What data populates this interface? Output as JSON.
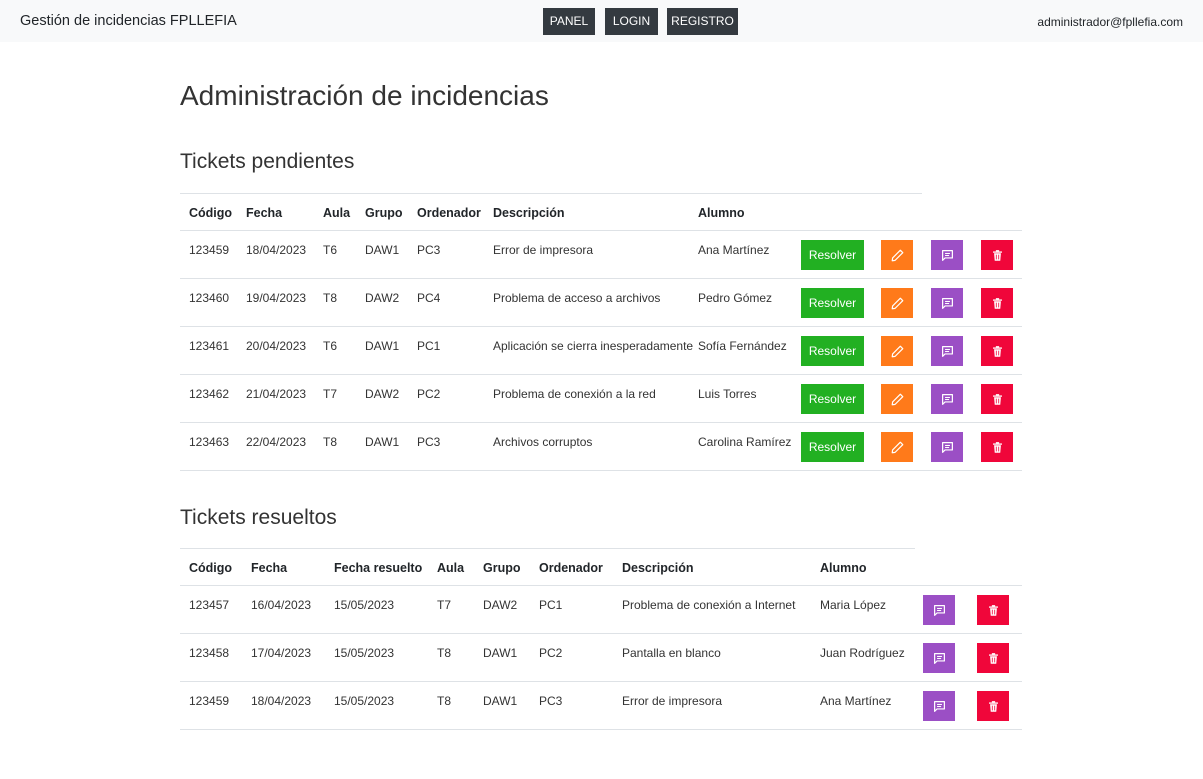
{
  "navbar": {
    "brand": "Gestión de incidencias FPLLEFIA",
    "buttons": [
      "PANEL",
      "LOGIN",
      "REGISTRO"
    ],
    "user_email": "administrador@fpllefia.com"
  },
  "page_title": "Administración de incidencias",
  "pending": {
    "title": "Tickets pendientes",
    "headers": [
      "Código",
      "Fecha",
      "Aula",
      "Grupo",
      "Ordenador",
      "Descripción",
      "Alumno"
    ],
    "resolve_label": "Resolver",
    "rows": [
      [
        "123459",
        "18/04/2023",
        "T6",
        "DAW1",
        "PC3",
        "Error de impresora",
        "Ana Martínez"
      ],
      [
        "123460",
        "19/04/2023",
        "T8",
        "DAW2",
        "PC4",
        "Problema de acceso a archivos",
        "Pedro Gómez"
      ],
      [
        "123461",
        "20/04/2023",
        "T6",
        "DAW1",
        "PC1",
        "Aplicación se cierra inesperadamente",
        "Sofía Fernández"
      ],
      [
        "123462",
        "21/04/2023",
        "T7",
        "DAW2",
        "PC2",
        "Problema de conexión a la red",
        "Luis Torres"
      ],
      [
        "123463",
        "22/04/2023",
        "T8",
        "DAW1",
        "PC3",
        "Archivos corruptos",
        "Carolina Ramírez"
      ]
    ]
  },
  "resolved": {
    "title": "Tickets resueltos",
    "headers": [
      "Código",
      "Fecha",
      "Fecha resuelto",
      "Aula",
      "Grupo",
      "Ordenador",
      "Descripción",
      "Alumno"
    ],
    "rows": [
      [
        "123457",
        "16/04/2023",
        "15/05/2023",
        "T7",
        "DAW2",
        "PC1",
        "Problema de conexión a Internet",
        "Maria López"
      ],
      [
        "123458",
        "17/04/2023",
        "15/05/2023",
        "T8",
        "DAW1",
        "PC2",
        "Pantalla en blanco",
        "Juan Rodríguez"
      ],
      [
        "123459",
        "18/04/2023",
        "15/05/2023",
        "T8",
        "DAW1",
        "PC3",
        "Error de impresora",
        "Ana Martínez"
      ]
    ]
  },
  "icons": {
    "edit": "pencil-icon",
    "comment": "comment-icon",
    "delete": "trash-icon"
  },
  "colors": {
    "resolve": "#22b022",
    "edit": "#ff7a1a",
    "comment": "#9b4fc5",
    "delete": "#f0063a",
    "navbar_button": "#343a40"
  }
}
